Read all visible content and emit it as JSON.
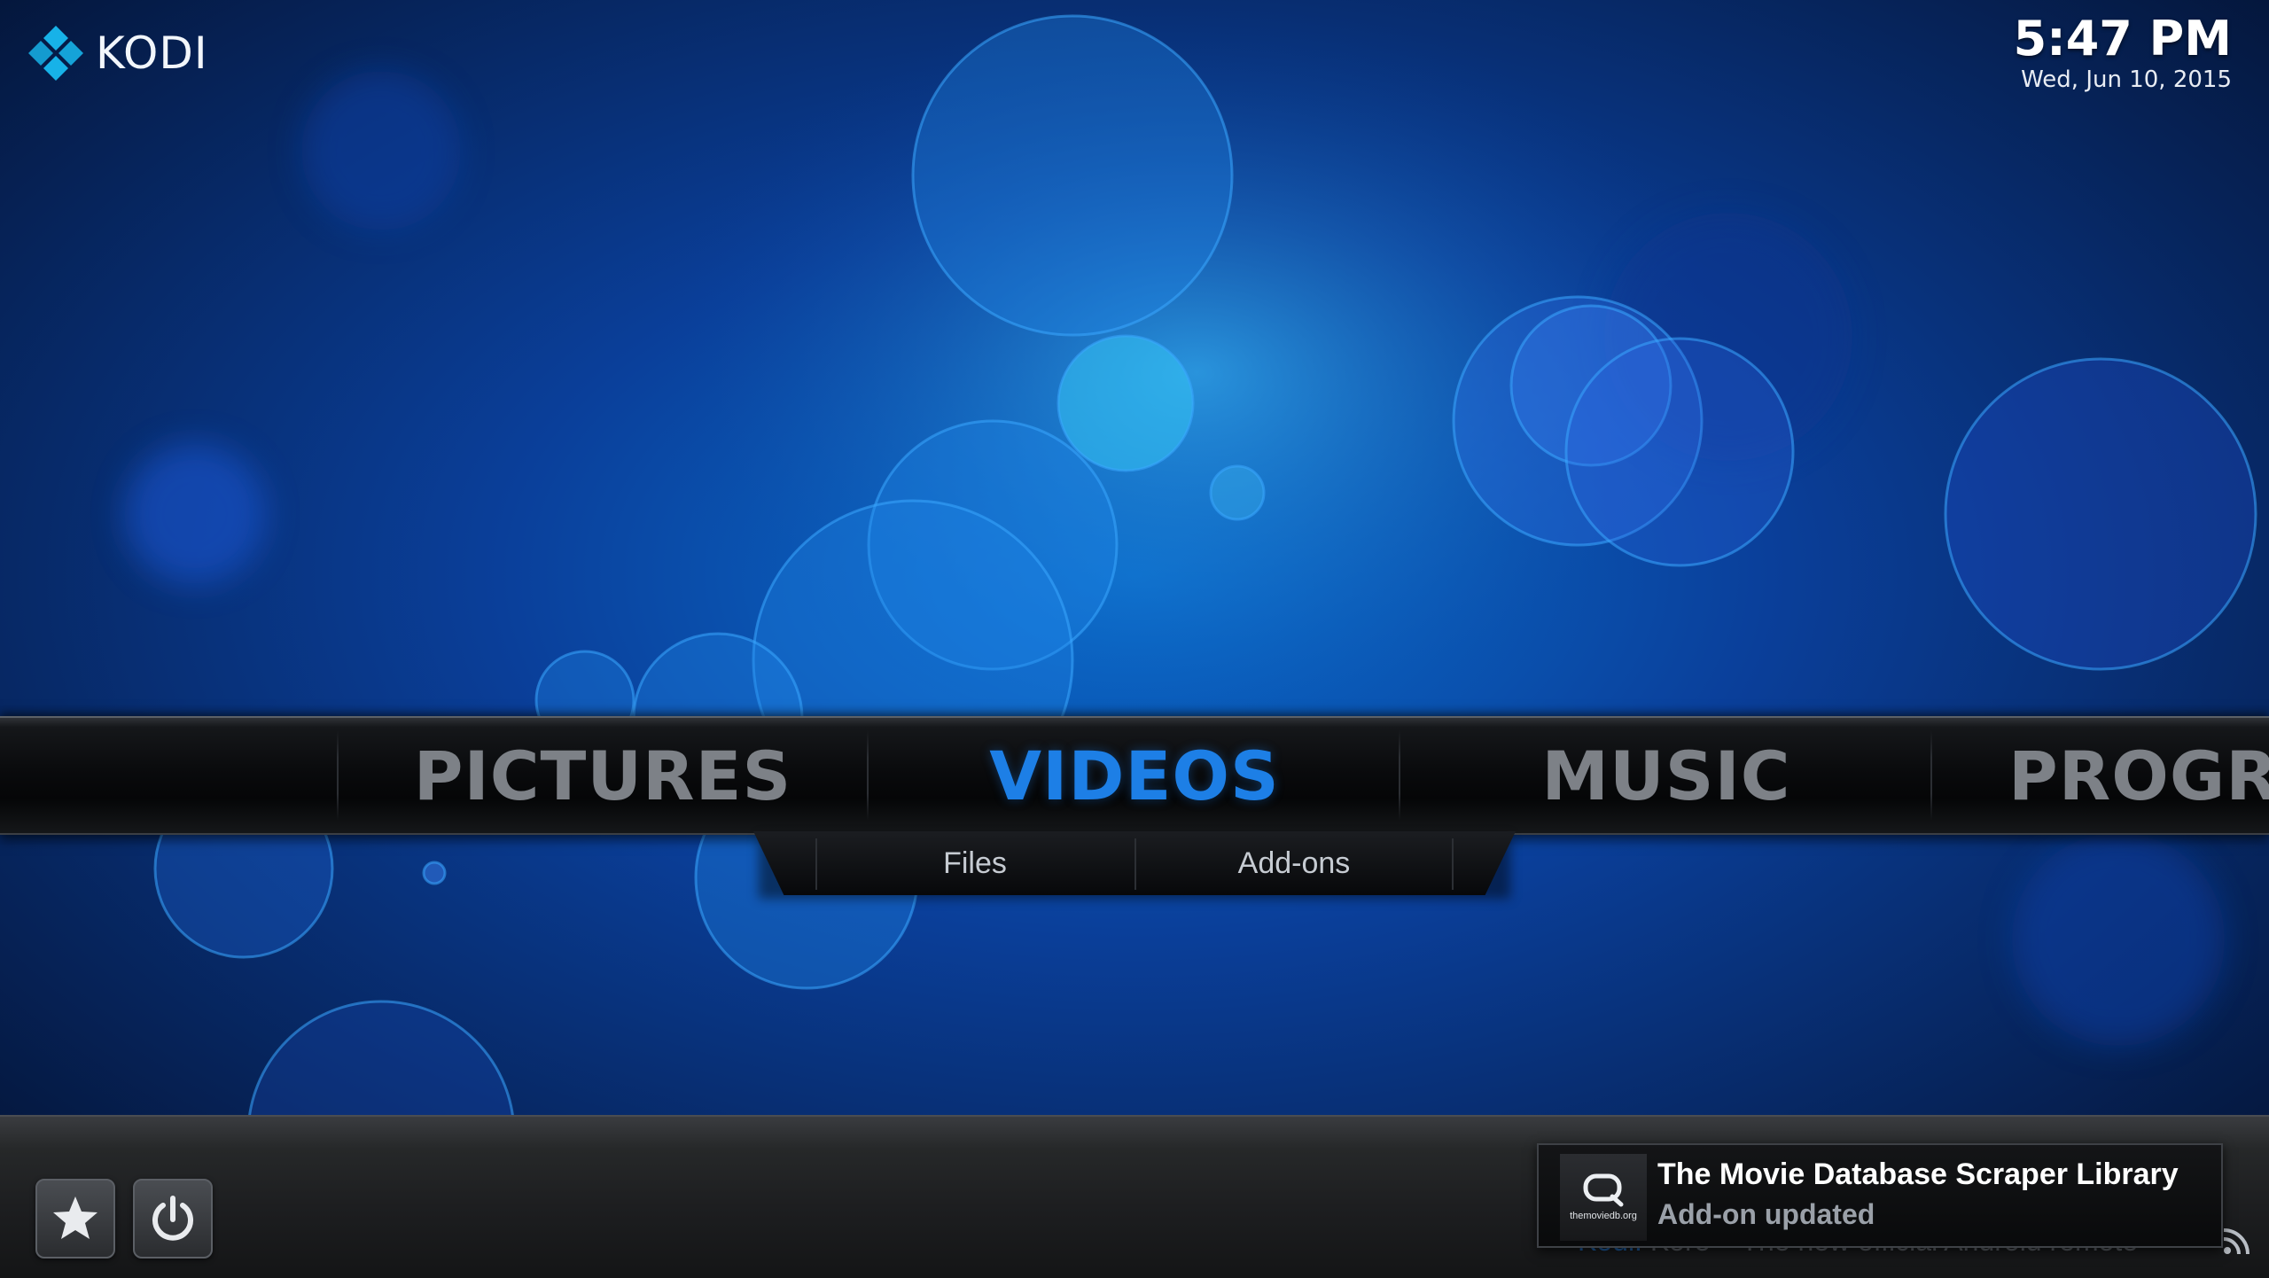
{
  "app": {
    "name": "KODI"
  },
  "clock": {
    "time": "5:47 PM",
    "date": "Wed, Jun 10, 2015"
  },
  "main_menu": {
    "items": [
      {
        "label": "PICTURES",
        "active": false
      },
      {
        "label": "VIDEOS",
        "active": true
      },
      {
        "label": "MUSIC",
        "active": false
      },
      {
        "label": "PROGRA",
        "active": false
      }
    ]
  },
  "submenu": {
    "items": [
      {
        "label": "Files"
      },
      {
        "label": "Add-ons"
      }
    ]
  },
  "bottom_bar": {
    "favourites_icon": "star-icon",
    "power_icon": "power-icon"
  },
  "rss": {
    "source": "Kodi:",
    "headline": "Kore – The new official Android remote"
  },
  "notification": {
    "title": "The Movie Database Scraper Library",
    "message": "Add-on updated",
    "icon_text": "themoviedb.org"
  },
  "colors": {
    "accent": "#1d7fe6",
    "inactive_menu": "#7d8187",
    "background": "#06245e"
  }
}
